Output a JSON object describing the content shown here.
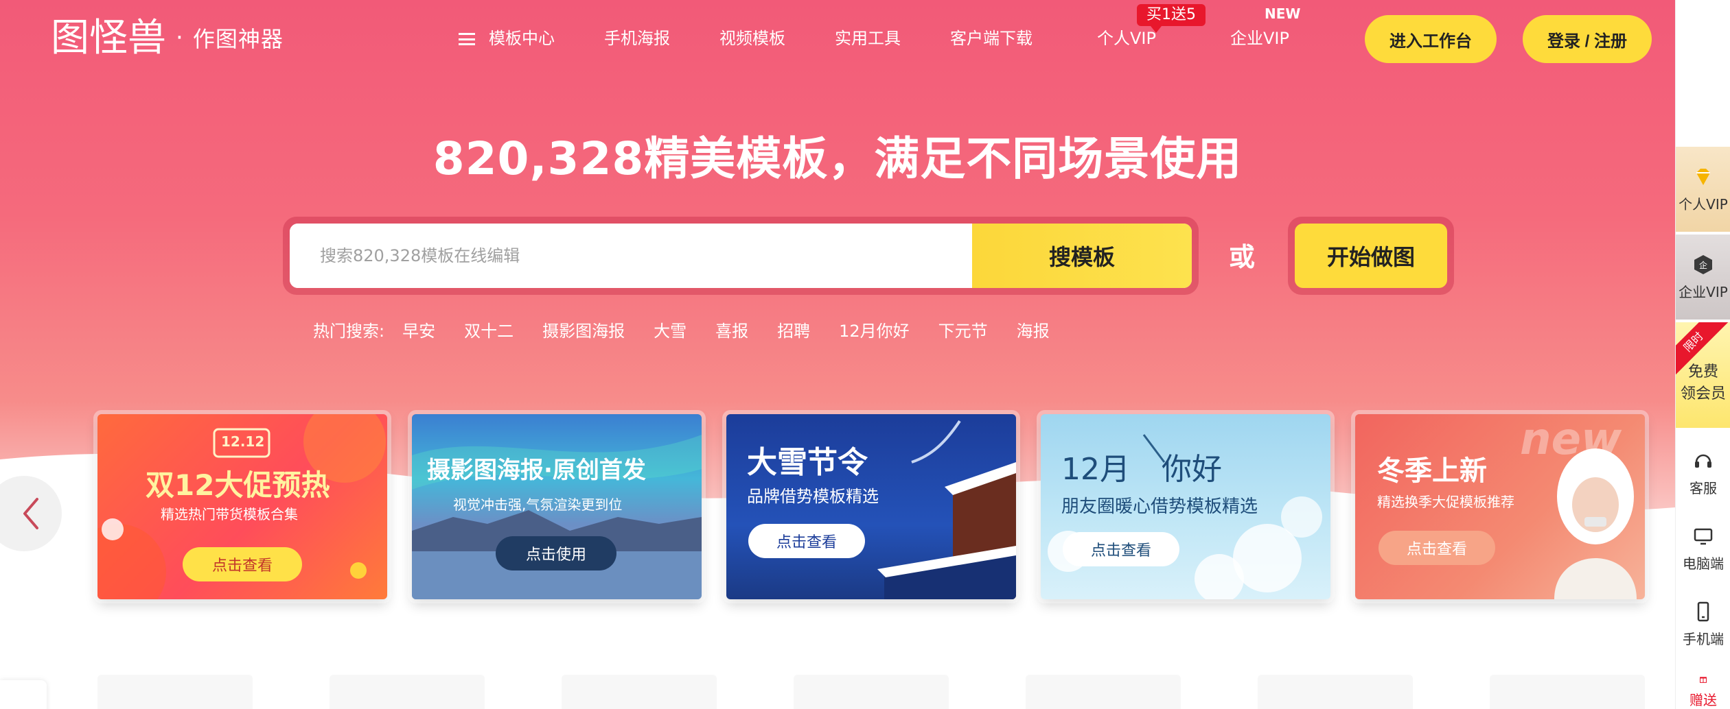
{
  "header": {
    "logo_text": "图怪兽",
    "slogan": "作图神器",
    "nav": {
      "template_center": "模板中心",
      "mobile_poster": "手机海报",
      "video_template": "视频模板",
      "tools": "实用工具",
      "client_download": "客户端下载",
      "personal_vip": "个人VIP",
      "enterprise_vip": "企业VIP"
    },
    "promo_badge": "买1送5",
    "new_badge": "NEW",
    "workbench_button": "进入工作台",
    "login_button": "登录 / 注册"
  },
  "hero": {
    "headline": "820,328精美模板，满足不同场景使用",
    "search_placeholder": "搜索820,328模板在线编辑",
    "search_button": "搜模板",
    "or_text": "或",
    "start_button": "开始做图",
    "hot_label": "热门搜索:",
    "hot_searches": [
      "早安",
      "双十二",
      "摄影图海报",
      "大雪",
      "喜报",
      "招聘",
      "12月你好",
      "下元节",
      "海报"
    ]
  },
  "banners": [
    {
      "badge": "12.12",
      "title": "双12大促预热",
      "subtitle": "精选热门带货模板合集",
      "button": "点击查看"
    },
    {
      "title": "摄影图海报·原创首发",
      "subtitle": "视觉冲击强,气氛渲染更到位",
      "button": "点击使用"
    },
    {
      "title": "大雪节令",
      "subtitle": "品牌借势模板精选",
      "button": "点击查看"
    },
    {
      "title_a": "12月",
      "title_b": "你好",
      "subtitle": "朋友圈暖心借势模板精选",
      "button": "点击查看"
    },
    {
      "watermark": "new",
      "title": "冬季上新",
      "subtitle": "精选换季大促模板推荐",
      "button": "点击查看"
    }
  ],
  "sidebar": {
    "personal_vip": "个人VIP",
    "enterprise_vip": "企业VIP",
    "limited_badge": "限时",
    "free_member_line1": "免费",
    "free_member_line2": "领会员",
    "service": "客服",
    "desktop": "电脑端",
    "mobile": "手机端",
    "gift": "赠送"
  },
  "colors": {
    "hero_pink": "#f25a78",
    "accent_yellow": "#fedb3b",
    "badge_red": "#e8172c"
  },
  "icons": [
    "hamburger-icon",
    "chevron-left-icon",
    "diamond-icon",
    "enterprise-icon",
    "headset-icon",
    "desktop-icon",
    "mobile-icon",
    "gift-icon"
  ]
}
